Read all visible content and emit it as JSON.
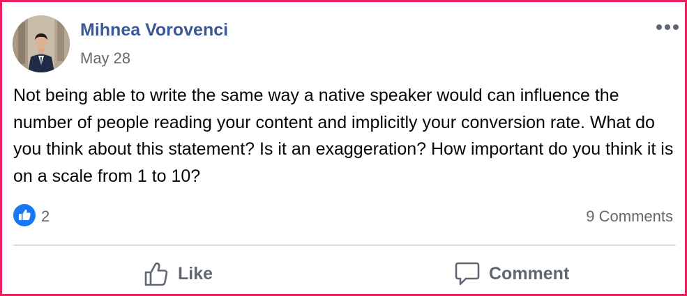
{
  "post": {
    "author": "Mihnea Vorovenci",
    "date": "May 28",
    "text": "Not being able to write the same way a native speaker would can influence the number of people reading your content and implicitly your conversion rate. What do you think about this statement? Is it an exaggeration? How important do you think it is on a scale from 1 to 10?"
  },
  "reactions": {
    "like_count": "2",
    "comments_label": "9 Comments"
  },
  "actions": {
    "like_label": "Like",
    "comment_label": "Comment"
  },
  "icons": {
    "more": "more-options-icon",
    "like_badge": "like-reaction-icon",
    "like": "thumbs-up-icon",
    "comment": "comment-bubble-icon"
  },
  "colors": {
    "frame_border": "#ec1f5d",
    "author_name": "#3b5998",
    "like_badge": "#1877f2",
    "secondary_text": "#65676b"
  }
}
